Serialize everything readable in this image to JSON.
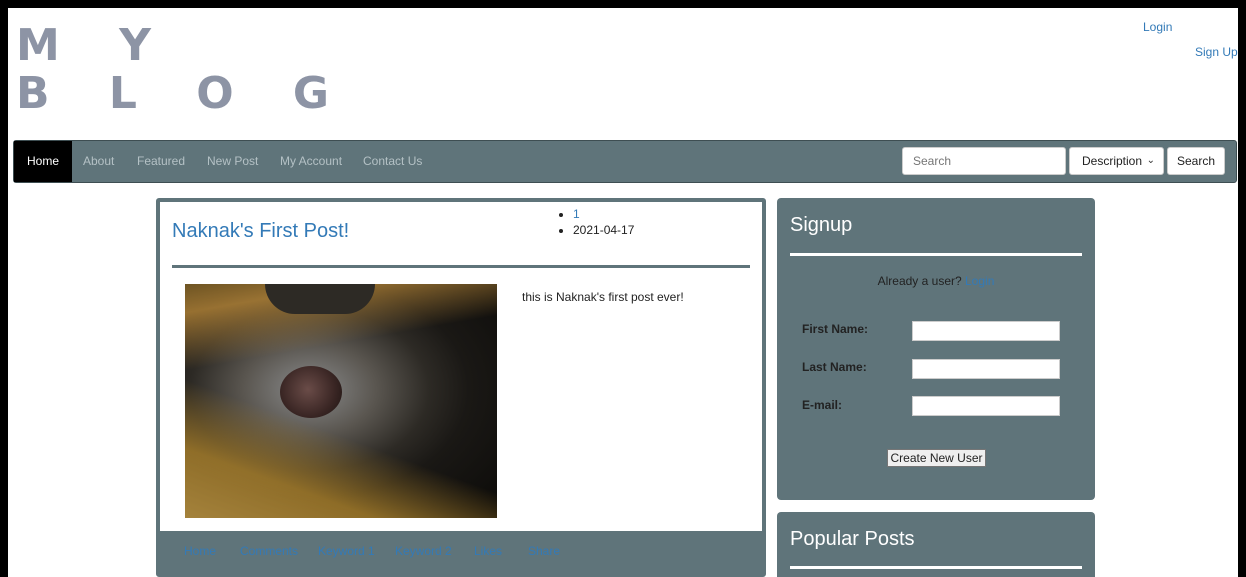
{
  "header": {
    "logo_line1": "M Y",
    "logo_line2": "B L O G",
    "login_link": "Login",
    "signup_link": "Sign Up"
  },
  "nav": {
    "items": [
      "Home",
      "About",
      "Featured",
      "New Post",
      "My Account",
      "Contact Us"
    ],
    "active": "Home",
    "search_placeholder": "Search",
    "search_select_value": "Description",
    "search_button": "Search"
  },
  "post": {
    "title": "Naknak's First Post!",
    "meta": [
      "1",
      "2021-04-17"
    ],
    "body": "this is Naknak's first post ever!",
    "image_icon": "cat-photo",
    "footer_links": [
      "Home",
      "Comments",
      "Keyword 1",
      "Keyword 2",
      "Likes",
      "Share"
    ]
  },
  "signup": {
    "title": "Signup",
    "already_text": "Already a user?",
    "already_link": "Login",
    "fields": [
      "First Name:",
      "Last Name:",
      "E-mail:"
    ],
    "button": "Create New User"
  },
  "popular": {
    "title": "Popular Posts"
  },
  "colors": {
    "panel": "#5f747a",
    "link": "#337ab7",
    "logo": "#8d94a5"
  }
}
